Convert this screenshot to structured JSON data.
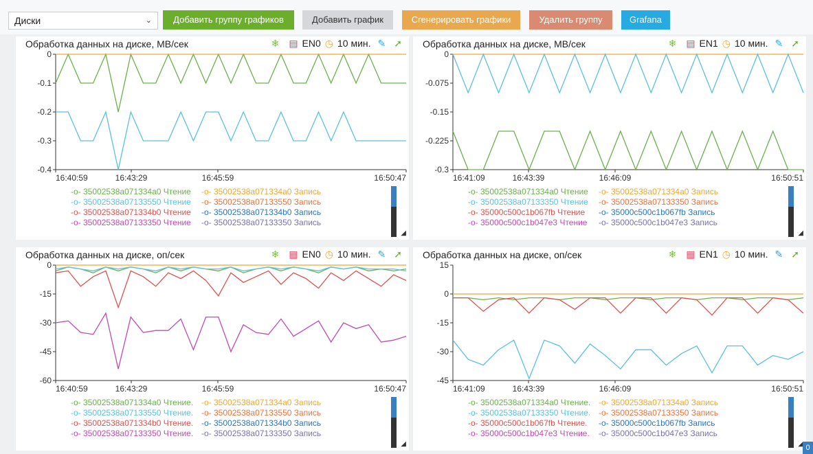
{
  "toolbar": {
    "select_value": "Диски",
    "buttons": [
      {
        "label": "Добавить группу графиков",
        "color": "#6aae2b"
      },
      {
        "label": "Добавить график",
        "color": "#d5d7da"
      },
      {
        "label": "Сгенерировать графики",
        "color": "#e9a84d"
      },
      {
        "label": "Удалить группу",
        "color": "#d98a70"
      },
      {
        "label": "Grafana",
        "color": "#27a9e1"
      }
    ]
  },
  "panels": [
    {
      "title": "Обработка данных на диске, МВ/сек",
      "group": "EN0",
      "interval": "10 мин."
    },
    {
      "title": "Обработка данных на диске, МВ/сек",
      "group": "EN1",
      "interval": "10 мин."
    },
    {
      "title": "Обработка данных на диске, оп/сек",
      "group": "EN0",
      "interval": "10 мин."
    },
    {
      "title": "Обработка данных на диске, оп/сек",
      "group": "EN1",
      "interval": "10 мин."
    }
  ],
  "corner_badge": "0",
  "chart_data": [
    {
      "type": "line",
      "x": [
        "16:40:59",
        "16:43:29",
        "16:45:59",
        "16:50:47"
      ],
      "y_ticks": [
        "0",
        "-0.1",
        "-0.2",
        "-0.3",
        "-0.4"
      ],
      "ylim": [
        -0.4,
        0
      ],
      "series": [
        {
          "name": "35002538a071334a0 Чтение",
          "color": "#6ab04c",
          "values": [
            -0.1,
            0,
            -0.1,
            -0.1,
            0,
            -0.2,
            0,
            -0.1,
            -0.1,
            0,
            -0.1,
            0,
            -0.1,
            0,
            -0.1,
            0,
            -0.1,
            -0.1,
            0,
            -0.1,
            -0.1,
            0,
            -0.1,
            0,
            -0.1,
            0,
            -0.1,
            -0.1,
            -0.1
          ]
        },
        {
          "name": "35002538a071334a0 Запись",
          "color": "#f0a830",
          "values": [
            0,
            0,
            0,
            0,
            0,
            0,
            0,
            0,
            0,
            0,
            0,
            0,
            0,
            0,
            0,
            0,
            0,
            0,
            0,
            0,
            0,
            0,
            0,
            0,
            0,
            0,
            0,
            0,
            0
          ]
        },
        {
          "name": "35002538a07133550 Чтение",
          "color": "#5bc0de",
          "values": [
            -0.2,
            -0.2,
            -0.3,
            -0.3,
            -0.2,
            -0.4,
            -0.2,
            -0.3,
            -0.3,
            -0.3,
            -0.2,
            -0.3,
            -0.2,
            -0.2,
            -0.3,
            -0.2,
            -0.3,
            -0.3,
            -0.2,
            -0.3,
            -0.3,
            -0.2,
            -0.3,
            -0.2,
            -0.3,
            -0.3,
            -0.3,
            -0.3,
            -0.3
          ]
        },
        {
          "name": "35002538a07133550 Запись",
          "color": "#e8733a",
          "values": []
        },
        {
          "name": "35002538a071334b0 Чтение",
          "color": "#d9534f",
          "values": []
        },
        {
          "name": "35002538a071334b0 Запись",
          "color": "#2a75bb",
          "values": []
        },
        {
          "name": "35002538a07133350 Чтение",
          "color": "#c04ab0",
          "values": []
        },
        {
          "name": "35002538a07133350 Запись",
          "color": "#7b6fb0",
          "values": []
        }
      ]
    },
    {
      "type": "line",
      "x": [
        "16:41:09",
        "16:43:39",
        "16:46:09",
        "16:50:51"
      ],
      "y_ticks": [
        "0",
        "-0.075",
        "-0.15",
        "-0.225",
        "-0.3"
      ],
      "ylim": [
        -0.3,
        0
      ],
      "series": [
        {
          "name": "35002538a071334a0 Чтение",
          "color": "#6ab04c",
          "values": [
            -0.2,
            -0.3,
            -0.3,
            -0.2,
            -0.2,
            -0.3,
            -0.2,
            -0.2,
            -0.3,
            -0.2,
            -0.3,
            -0.2,
            -0.3,
            -0.2,
            -0.3,
            -0.2,
            -0.3,
            -0.2,
            -0.3,
            -0.2,
            -0.3,
            -0.2,
            -0.3,
            -0.3
          ]
        },
        {
          "name": "35002538a071334a0 Запись",
          "color": "#f0a830",
          "values": [
            0,
            0,
            0,
            0,
            0,
            0,
            0,
            0,
            0,
            0,
            0,
            0,
            0,
            0,
            0,
            0,
            0,
            0,
            0,
            0,
            0,
            0,
            0,
            0
          ]
        },
        {
          "name": "35002538a07133350 Чтение",
          "color": "#5bc0de",
          "values": [
            0,
            -0.1,
            0,
            -0.1,
            0,
            -0.1,
            0,
            -0.1,
            0,
            -0.1,
            0,
            -0.1,
            0,
            -0.1,
            0,
            -0.1,
            0,
            -0.1,
            0,
            -0.1,
            0,
            -0.1,
            0,
            -0.1
          ]
        },
        {
          "name": "35002538a07133350 Запись",
          "color": "#e8733a",
          "values": []
        },
        {
          "name": "35000c500c1b067fb Чтение",
          "color": "#d9534f",
          "values": []
        },
        {
          "name": "35000c500c1b067fb Запись",
          "color": "#2a75bb",
          "values": []
        },
        {
          "name": "35000c500c1b047e3 Чтение",
          "color": "#c04ab0",
          "values": []
        },
        {
          "name": "35000c500c1b047e3 Запись",
          "color": "#7b6fb0",
          "values": []
        }
      ]
    },
    {
      "type": "line",
      "x": [
        "16:40:59",
        "16:43:29",
        "16:45:59",
        "16:50:47"
      ],
      "y_ticks": [
        "0",
        "-15",
        "-30",
        "-45",
        "-60"
      ],
      "ylim": [
        -60,
        0
      ],
      "series": [
        {
          "name": "35002538a071334a0 Чтение.",
          "color": "#6ab04c",
          "values": [
            -3,
            -1,
            -2,
            -4,
            -1,
            -3,
            -1,
            -2,
            -4,
            -1,
            -3,
            -1,
            -2,
            -3,
            -1,
            -4,
            -2,
            -1,
            -3,
            -1,
            -2,
            -4,
            -1,
            -2,
            -1,
            -3,
            -2,
            -3,
            -2
          ]
        },
        {
          "name": "35002538a071334a0 Запись",
          "color": "#f0a830",
          "values": [
            0,
            0,
            0,
            0,
            0,
            0,
            0,
            0,
            0,
            0,
            0,
            0,
            0,
            0,
            0,
            0,
            0,
            0,
            0,
            0,
            0,
            0,
            0,
            0,
            0,
            0,
            0,
            0,
            0
          ]
        },
        {
          "name": "35002538a07133550 Чтение.",
          "color": "#5bc0de",
          "values": [
            -2,
            -1,
            -2,
            -3,
            -1,
            -2,
            -1,
            -2,
            -3,
            -1,
            -2,
            -1,
            -2,
            -2,
            -1,
            -3,
            -2,
            -1,
            -2,
            -1,
            -2,
            -3,
            -1,
            -2,
            -1,
            -2,
            -2,
            -2,
            -3
          ]
        },
        {
          "name": "35002538a07133550 Запись",
          "color": "#e8733a",
          "values": []
        },
        {
          "name": "35002538a071334b0 Чтение.",
          "color": "#d9534f",
          "values": [
            -4,
            -3,
            -11,
            -6,
            -3,
            -22,
            -3,
            -6,
            -11,
            -4,
            -7,
            -3,
            -8,
            -16,
            -4,
            -9,
            -6,
            -3,
            -10,
            -4,
            -7,
            -12,
            -4,
            -8,
            -3,
            -7,
            -11,
            -5,
            -8
          ]
        },
        {
          "name": "35002538a071334b0 Запись",
          "color": "#2a75bb",
          "values": []
        },
        {
          "name": "35002538a07133350 Чтение.",
          "color": "#c04ab0",
          "values": [
            -30,
            -29,
            -35,
            -36,
            -25,
            -54,
            -27,
            -35,
            -34,
            -34,
            -28,
            -44,
            -27,
            -27,
            -45,
            -31,
            -35,
            -36,
            -28,
            -37,
            -33,
            -29,
            -40,
            -30,
            -33,
            -31,
            -40,
            -39,
            -37
          ]
        },
        {
          "name": "35002538a07133350 Запись",
          "color": "#7b6fb0",
          "values": []
        }
      ]
    },
    {
      "type": "line",
      "x": [
        "16:41:09",
        "16:43:39",
        "16:46:09",
        "16:50:51"
      ],
      "y_ticks": [
        "15",
        "0",
        "-15",
        "-30",
        "-45"
      ],
      "ylim": [
        -45,
        15
      ],
      "series": [
        {
          "name": "35002538a071334a0 Чтение.",
          "color": "#6ab04c",
          "values": [
            -2,
            -2,
            -3,
            -2,
            -3,
            -2,
            -2,
            -3,
            -2,
            -2,
            -3,
            -2,
            -2,
            -3,
            -2,
            -2,
            -3,
            -2,
            -2,
            -3,
            -2,
            -2,
            -3,
            -2
          ]
        },
        {
          "name": "35002538a071334a0 Запись",
          "color": "#f0a830",
          "values": [
            0,
            0,
            0,
            0,
            0,
            0,
            0,
            0,
            0,
            0,
            0,
            0,
            0,
            0,
            0,
            0,
            0,
            0,
            0,
            0,
            0,
            0,
            0,
            0
          ]
        },
        {
          "name": "35002538a07133350 Чтение.",
          "color": "#5bc0de",
          "values": [
            -24,
            -34,
            -37,
            -29,
            -24,
            -44,
            -24,
            -27,
            -36,
            -26,
            -32,
            -39,
            -29,
            -29,
            -37,
            -31,
            -27,
            -41,
            -27,
            -27,
            -37,
            -32,
            -34,
            -30
          ]
        },
        {
          "name": "35002538a07133350 Запись",
          "color": "#e8733a",
          "values": []
        },
        {
          "name": "35000c500c1b067fb Чтение.",
          "color": "#d9534f",
          "values": [
            -2,
            -2,
            -9,
            -3,
            -2,
            -10,
            -2,
            -3,
            -8,
            -2,
            -2,
            -10,
            -2,
            -2,
            -10,
            -2,
            -3,
            -11,
            -2,
            -2,
            -10,
            -2,
            -3,
            -10
          ]
        },
        {
          "name": "35000c500c1b067fb Запись",
          "color": "#2a75bb",
          "values": []
        },
        {
          "name": "35000c500c1b047e3 Чтение.",
          "color": "#c04ab0",
          "values": []
        },
        {
          "name": "35000c500c1b047e3 Запись",
          "color": "#7b6fb0",
          "values": []
        }
      ]
    }
  ]
}
